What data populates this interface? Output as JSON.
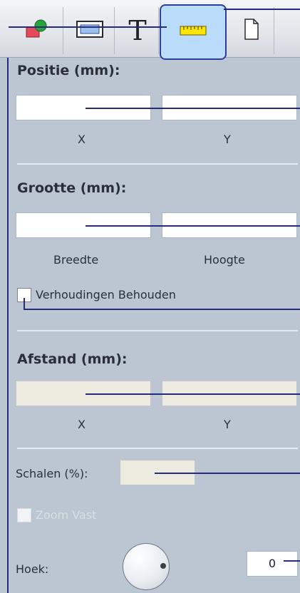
{
  "toolbar": {
    "tabs": [
      {
        "icon": "shapes-icon",
        "active": false
      },
      {
        "icon": "frame-icon",
        "active": false
      },
      {
        "icon": "text-icon",
        "glyph": "T",
        "active": false
      },
      {
        "icon": "ruler-icon",
        "active": true
      },
      {
        "icon": "page-icon",
        "active": false
      }
    ]
  },
  "position": {
    "heading": "Positie (mm):",
    "x_label": "X",
    "y_label": "Y",
    "x_value": "",
    "y_value": ""
  },
  "size": {
    "heading": "Grootte (mm):",
    "width_label": "Breedte",
    "height_label": "Hoogte",
    "width_value": "",
    "height_value": "",
    "keep_ratio_label": "Verhoudingen Behouden"
  },
  "distance": {
    "heading": "Afstand (mm):",
    "x_label": "X",
    "y_label": "Y",
    "x_value": "",
    "y_value": ""
  },
  "scale": {
    "label": "Schalen (%):",
    "value": "",
    "zoom_fixed_label": "Zoom Vast"
  },
  "angle": {
    "label": "Hoek:",
    "value": "0"
  },
  "colors": {
    "panel": "#bcc6d2",
    "accent": "#2c3e9c",
    "leader": "#262a7a"
  }
}
